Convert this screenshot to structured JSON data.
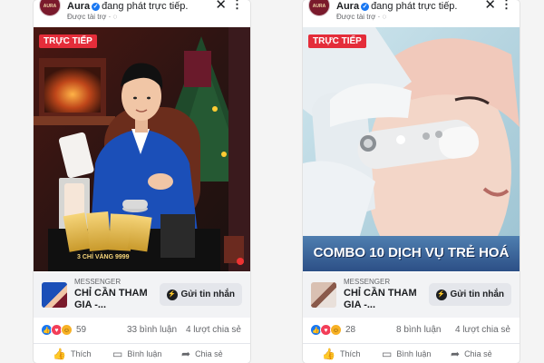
{
  "posts": [
    {
      "page_name": "Aura",
      "status": "đang phát trực tiếp.",
      "sponsored": "Được tài trợ",
      "live_badge": "TRỰC TIẾP",
      "overlay_caption": "3 CHỈ VÀNG 9999",
      "cta": {
        "label": "MESSENGER",
        "title": "CHỈ CẦN THAM GIA -...",
        "button": "Gửi tin nhắn"
      },
      "reaction_count": "59",
      "comments": "33 bình luận",
      "shares": "4 lượt chia sẻ",
      "actions": {
        "like": "Thích",
        "comment": "Bình luận",
        "share": "Chia sẻ"
      }
    },
    {
      "page_name": "Aura",
      "status": "đang phát trực tiếp.",
      "sponsored": "Được tài trợ",
      "live_badge": "TRỰC TIẾP",
      "overlay_caption": "COMBO 10 DỊCH VỤ TRẺ HOÁ",
      "cta": {
        "label": "MESSENGER",
        "title": "CHỈ CẦN THAM GIA -...",
        "button": "Gửi tin nhắn"
      },
      "reaction_count": "28",
      "comments": "8 bình luận",
      "shares": "4 lượt chia sẻ",
      "actions": {
        "like": "Thích",
        "comment": "Bình luận",
        "share": "Chia sẻ"
      }
    }
  ],
  "colors": {
    "live": "#e42d3a",
    "verified": "#1877f2",
    "brand": "#7a1a2c"
  },
  "icons": [
    "verified-icon",
    "close-icon",
    "more-icon",
    "messenger-icon",
    "like-icon",
    "comment-icon",
    "share-icon"
  ]
}
